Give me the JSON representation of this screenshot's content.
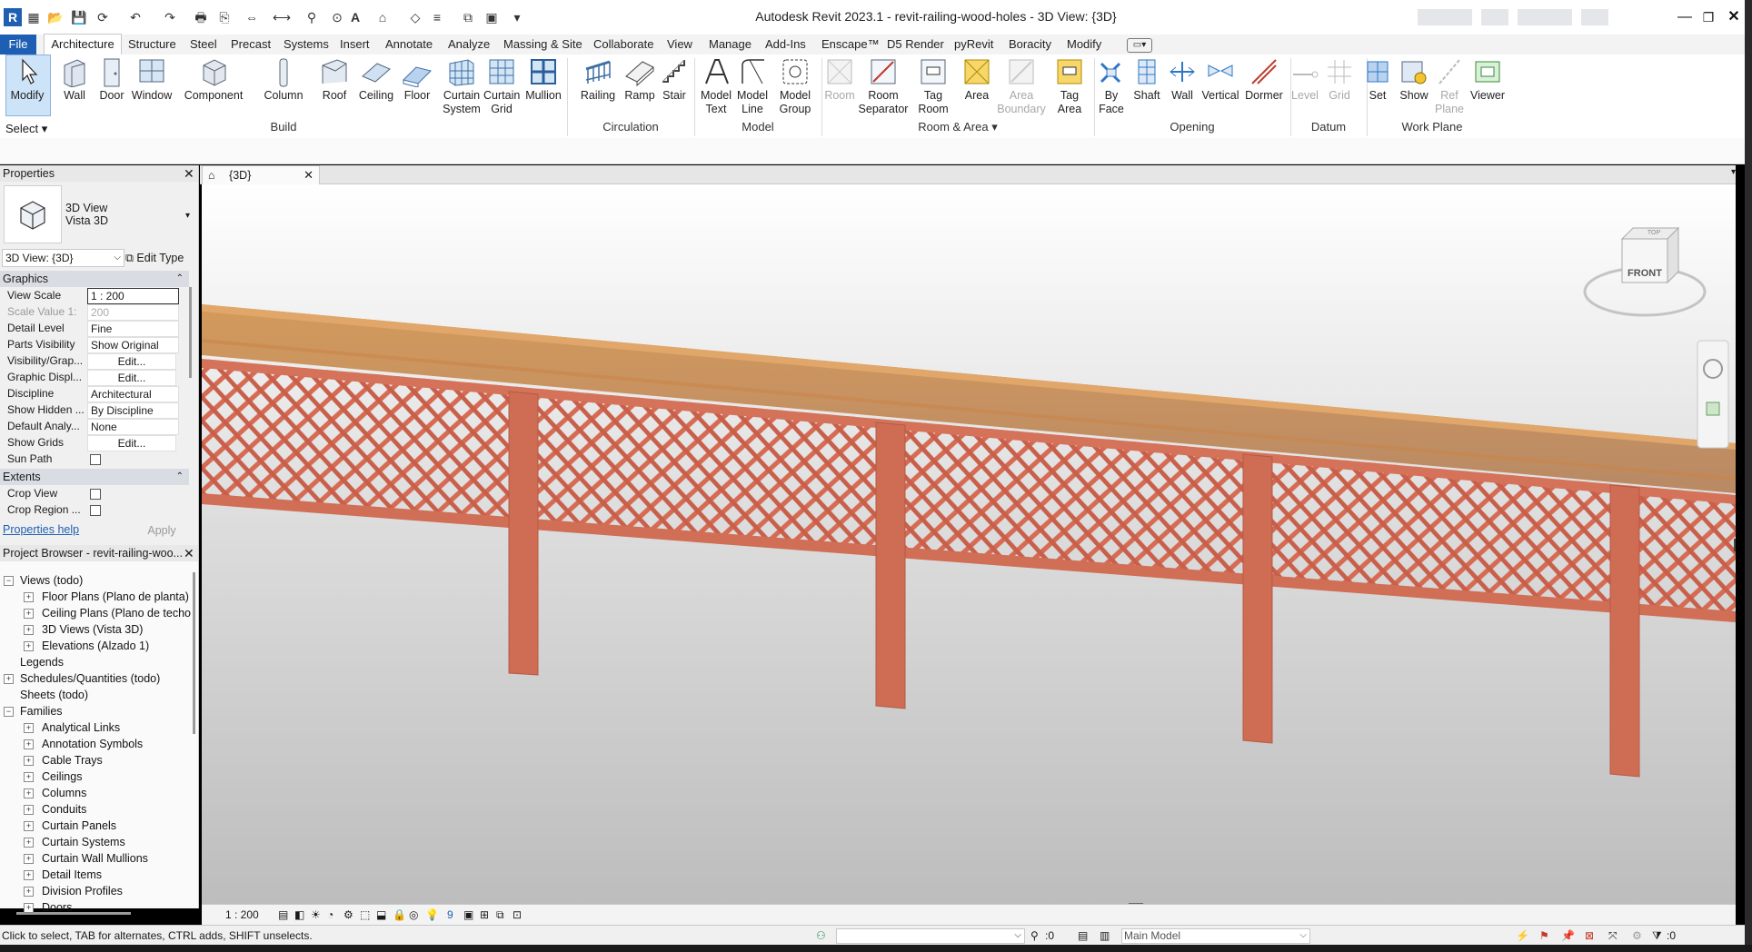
{
  "window": {
    "title": "Autodesk Revit 2023.1 - revit-railing-wood-holes - 3D View: {3D}",
    "app_logo": "R",
    "minimize": "—",
    "restore": "❐",
    "close": "✕"
  },
  "ribbon_tabs": [
    "File",
    "Architecture",
    "Structure",
    "Steel",
    "Precast",
    "Systems",
    "Insert",
    "Annotate",
    "Analyze",
    "Massing & Site",
    "Collaborate",
    "View",
    "Manage",
    "Add-Ins",
    "Enscape™",
    "D5 Render",
    "pyRevit",
    "Boracity",
    "Modify"
  ],
  "ribbon": {
    "select_label": "Select",
    "buttons": [
      {
        "label": "Modify",
        "icon": "cursor-icon"
      },
      {
        "label": "Wall",
        "icon": "wall-icon"
      },
      {
        "label": "Door",
        "icon": "door-icon"
      },
      {
        "label": "Window",
        "icon": "window-icon"
      },
      {
        "label": "Component",
        "icon": "component-icon"
      },
      {
        "label": "Column",
        "icon": "column-icon"
      },
      {
        "label": "Roof",
        "icon": "roof-icon"
      },
      {
        "label": "Ceiling",
        "icon": "ceiling-icon"
      },
      {
        "label": "Floor",
        "icon": "floor-icon"
      },
      {
        "label": "Curtain\nSystem",
        "icon": "curtain-system-icon"
      },
      {
        "label": "Curtain\nGrid",
        "icon": "curtain-grid-icon"
      },
      {
        "label": "Mullion",
        "icon": "mullion-icon"
      },
      {
        "label": "Railing",
        "icon": "railing-icon"
      },
      {
        "label": "Ramp",
        "icon": "ramp-icon"
      },
      {
        "label": "Stair",
        "icon": "stair-icon"
      },
      {
        "label": "Model\nText",
        "icon": "model-text-icon"
      },
      {
        "label": "Model\nLine",
        "icon": "model-line-icon"
      },
      {
        "label": "Model\nGroup",
        "icon": "model-group-icon"
      },
      {
        "label": "Room",
        "icon": "room-icon",
        "disabled": true
      },
      {
        "label": "Room\nSeparator",
        "icon": "room-separator-icon"
      },
      {
        "label": "Tag\nRoom",
        "icon": "tag-room-icon"
      },
      {
        "label": "Area",
        "icon": "area-icon"
      },
      {
        "label": "Area\nBoundary",
        "icon": "area-boundary-icon",
        "disabled": true
      },
      {
        "label": "Tag\nArea",
        "icon": "tag-area-icon"
      },
      {
        "label": "By\nFace",
        "icon": "by-face-icon"
      },
      {
        "label": "Shaft",
        "icon": "shaft-icon"
      },
      {
        "label": "Wall",
        "icon": "wall-opening-icon"
      },
      {
        "label": "Vertical",
        "icon": "vertical-icon"
      },
      {
        "label": "Dormer",
        "icon": "dormer-icon"
      },
      {
        "label": "Level",
        "icon": "level-icon",
        "disabled": true
      },
      {
        "label": "Grid",
        "icon": "grid-icon",
        "disabled": true
      },
      {
        "label": "Set",
        "icon": "set-icon"
      },
      {
        "label": "Show",
        "icon": "show-icon"
      },
      {
        "label": "Ref\nPlane",
        "icon": "ref-plane-icon",
        "disabled": true
      },
      {
        "label": "Viewer",
        "icon": "viewer-icon"
      }
    ],
    "panels": [
      "Build",
      "Circulation",
      "Model",
      "Room & Area",
      "Opening",
      "Datum",
      "Work Plane"
    ]
  },
  "properties": {
    "title": "Properties",
    "type_name": "3D View",
    "type_sub": "Vista 3D",
    "instance_selector": "3D View: {3D}",
    "edit_type": "Edit Type",
    "sections": [
      {
        "name": "Graphics"
      },
      {
        "name": "Extents"
      }
    ],
    "rows": [
      {
        "name": "View Scale",
        "value": "1 : 200"
      },
      {
        "name": "Scale Value    1:",
        "value": "200"
      },
      {
        "name": "Detail Level",
        "value": "Fine"
      },
      {
        "name": "Parts Visibility",
        "value": "Show Original"
      },
      {
        "name": "Visibility/Grap...",
        "value": "Edit..."
      },
      {
        "name": "Graphic Displ...",
        "value": "Edit..."
      },
      {
        "name": "Discipline",
        "value": "Architectural"
      },
      {
        "name": "Show Hidden ...",
        "value": "By Discipline"
      },
      {
        "name": "Default Analy...",
        "value": "None"
      },
      {
        "name": "Show Grids",
        "value": "Edit..."
      },
      {
        "name": "Sun Path",
        "value": ""
      },
      {
        "name": "Crop View",
        "value": ""
      },
      {
        "name": "Crop Region ...",
        "value": ""
      }
    ],
    "help": "Properties help",
    "apply": "Apply"
  },
  "browser": {
    "title": "Project Browser - revit-railing-woo...",
    "nodes": [
      {
        "label": "Views (todo)",
        "level": 0
      },
      {
        "label": "Floor Plans (Plano de planta)",
        "level": 1
      },
      {
        "label": "Ceiling Plans (Plano de techo",
        "level": 1
      },
      {
        "label": "3D Views (Vista 3D)",
        "level": 1
      },
      {
        "label": "Elevations (Alzado 1)",
        "level": 1
      },
      {
        "label": "Legends",
        "level": 0
      },
      {
        "label": "Schedules/Quantities (todo)",
        "level": 0
      },
      {
        "label": "Sheets (todo)",
        "level": 0
      },
      {
        "label": "Families",
        "level": 0
      },
      {
        "label": "Analytical Links",
        "level": 1
      },
      {
        "label": "Annotation Symbols",
        "level": 1
      },
      {
        "label": "Cable Trays",
        "level": 1
      },
      {
        "label": "Ceilings",
        "level": 1
      },
      {
        "label": "Columns",
        "level": 1
      },
      {
        "label": "Conduits",
        "level": 1
      },
      {
        "label": "Curtain Panels",
        "level": 1
      },
      {
        "label": "Curtain Systems",
        "level": 1
      },
      {
        "label": "Curtain Wall Mullions",
        "level": 1
      },
      {
        "label": "Detail Items",
        "level": 1
      },
      {
        "label": "Division Profiles",
        "level": 1
      },
      {
        "label": "Doors",
        "level": 1
      }
    ]
  },
  "view": {
    "tab_label": "{3D}",
    "viewcube_label": "FRONT",
    "viewcube_top": "TOP",
    "scale": "1 : 200",
    "detail_num": "9"
  },
  "status": {
    "hint": "Click to select, TAB for alternates, CTRL adds, SHIFT unselects.",
    "selection_count": ":0",
    "model_dropdown": "Main Model",
    "filter_count": ":0"
  }
}
